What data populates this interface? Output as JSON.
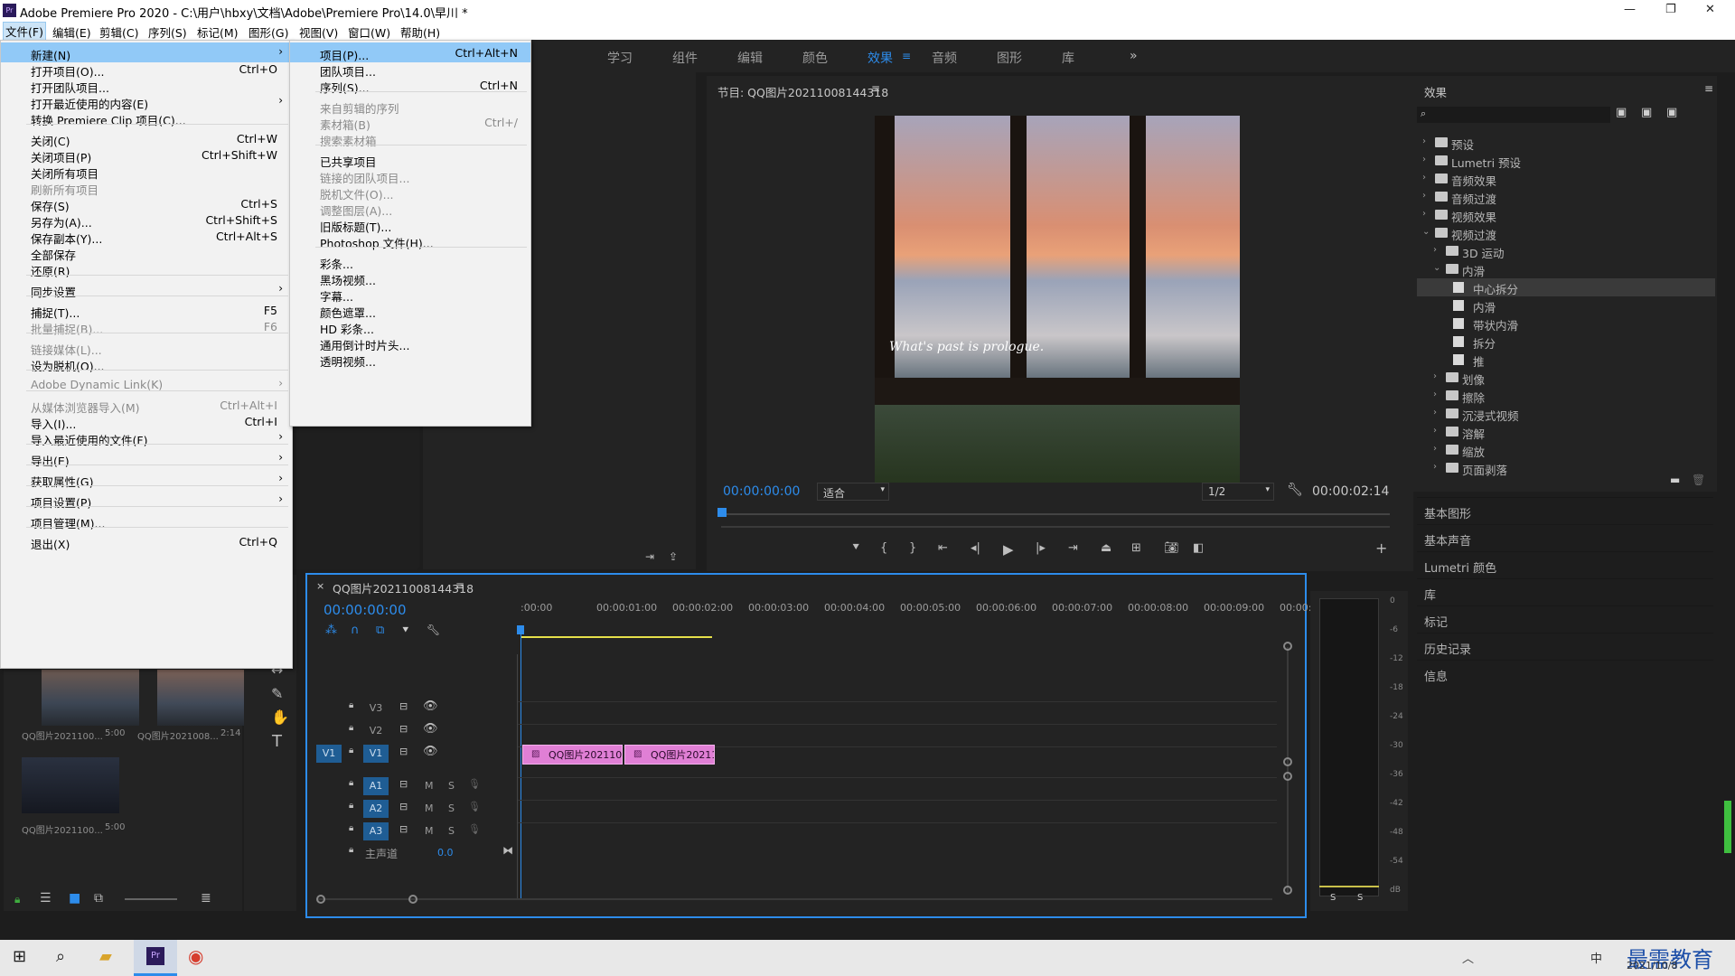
{
  "window": {
    "title": "Adobe Premiere Pro 2020 - C:\\用户\\hbxy\\文档\\Adobe\\Premiere Pro\\14.0\\早川 *",
    "app_icon": "Pr"
  },
  "menubar": [
    "文件(F)",
    "编辑(E)",
    "剪辑(C)",
    "序列(S)",
    "标记(M)",
    "图形(G)",
    "视图(V)",
    "窗口(W)",
    "帮助(H)"
  ],
  "workspaces": [
    "学习",
    "组件",
    "编辑",
    "颜色",
    "效果",
    "音频",
    "图形",
    "库",
    "»"
  ],
  "file_menu": [
    {
      "label": "新建(N)",
      "shortcut": "",
      "submenu": true,
      "disabled": false,
      "highlighted": true
    },
    {
      "label": "打开项目(O)...",
      "shortcut": "Ctrl+O"
    },
    {
      "label": "打开团队项目..."
    },
    {
      "label": "打开最近使用的内容(E)",
      "submenu": true
    },
    {
      "label": "转换 Premiere Clip 项目(C)..."
    },
    {
      "label": "关闭(C)",
      "shortcut": "Ctrl+W"
    },
    {
      "label": "关闭项目(P)",
      "shortcut": "Ctrl+Shift+W"
    },
    {
      "label": "关闭所有项目"
    },
    {
      "label": "刷新所有项目",
      "disabled": true
    },
    {
      "label": "保存(S)",
      "shortcut": "Ctrl+S"
    },
    {
      "label": "另存为(A)...",
      "shortcut": "Ctrl+Shift+S"
    },
    {
      "label": "保存副本(Y)...",
      "shortcut": "Ctrl+Alt+S"
    },
    {
      "label": "全部保存"
    },
    {
      "label": "还原(R)"
    },
    {
      "label": "同步设置",
      "submenu": true
    },
    {
      "label": "捕捉(T)...",
      "shortcut": "F5"
    },
    {
      "label": "批量捕捉(B)...",
      "shortcut": "F6",
      "disabled": true
    },
    {
      "label": "链接媒体(L)...",
      "disabled": true
    },
    {
      "label": "设为脱机(O)..."
    },
    {
      "label": "Adobe Dynamic Link(K)",
      "submenu": true,
      "disabled": true
    },
    {
      "label": "从媒体浏览器导入(M)",
      "shortcut": "Ctrl+Alt+I",
      "disabled": true
    },
    {
      "label": "导入(I)...",
      "shortcut": "Ctrl+I"
    },
    {
      "label": "导入最近使用的文件(F)",
      "submenu": true
    },
    {
      "label": "导出(E)",
      "submenu": true
    },
    {
      "label": "获取属性(G)",
      "submenu": true
    },
    {
      "label": "项目设置(P)",
      "submenu": true
    },
    {
      "label": "项目管理(M)..."
    },
    {
      "label": "退出(X)",
      "shortcut": "Ctrl+Q"
    }
  ],
  "new_submenu": [
    {
      "label": "项目(P)...",
      "shortcut": "Ctrl+Alt+N",
      "highlighted": true
    },
    {
      "label": "团队项目..."
    },
    {
      "label": "序列(S)...",
      "shortcut": "Ctrl+N"
    },
    {
      "label": "来自剪辑的序列",
      "disabled": true
    },
    {
      "label": "素材箱(B)",
      "shortcut": "Ctrl+/",
      "disabled": true
    },
    {
      "label": "搜索素材箱",
      "disabled": true
    },
    {
      "label": "已共享项目"
    },
    {
      "label": "链接的团队项目...",
      "disabled": true
    },
    {
      "label": "脱机文件(O)...",
      "disabled": true
    },
    {
      "label": "调整图层(A)...",
      "disabled": true
    },
    {
      "label": "旧版标题(T)..."
    },
    {
      "label": "Photoshop 文件(H)..."
    },
    {
      "label": "彩条..."
    },
    {
      "label": "黑场视频..."
    },
    {
      "label": "字幕..."
    },
    {
      "label": "颜色遮罩..."
    },
    {
      "label": "HD 彩条..."
    },
    {
      "label": "通用倒计时片头..."
    },
    {
      "label": "透明视频..."
    }
  ],
  "program_monitor": {
    "title": "节目: QQ图片20211008144318",
    "overlay_text": "What's past is prologue.",
    "timecode": "00:00:00:00",
    "fit": "适合",
    "resolution": "1/2",
    "duration": "00:00:02:14"
  },
  "effects_panel": {
    "title": "效果",
    "tree": [
      {
        "label": "预设",
        "level": 0,
        "type": "star-folder",
        "expanded": false
      },
      {
        "label": "Lumetri 预设",
        "level": 0,
        "type": "star-folder",
        "expanded": false
      },
      {
        "label": "音频效果",
        "level": 0,
        "type": "folder",
        "expanded": false
      },
      {
        "label": "音频过渡",
        "level": 0,
        "type": "folder",
        "expanded": false
      },
      {
        "label": "视频效果",
        "level": 0,
        "type": "folder",
        "expanded": false
      },
      {
        "label": "视频过渡",
        "level": 0,
        "type": "folder",
        "expanded": true
      },
      {
        "label": "3D 运动",
        "level": 1,
        "type": "folder",
        "expanded": false
      },
      {
        "label": "内滑",
        "level": 1,
        "type": "folder",
        "expanded": true
      },
      {
        "label": "中心拆分",
        "level": 2,
        "type": "effect",
        "selected": true
      },
      {
        "label": "内滑",
        "level": 2,
        "type": "effect"
      },
      {
        "label": "带状内滑",
        "level": 2,
        "type": "effect"
      },
      {
        "label": "拆分",
        "level": 2,
        "type": "effect"
      },
      {
        "label": "推",
        "level": 2,
        "type": "effect"
      },
      {
        "label": "划像",
        "level": 1,
        "type": "folder",
        "expanded": false
      },
      {
        "label": "擦除",
        "level": 1,
        "type": "folder",
        "expanded": false
      },
      {
        "label": "沉浸式视频",
        "level": 1,
        "type": "folder",
        "expanded": false
      },
      {
        "label": "溶解",
        "level": 1,
        "type": "folder",
        "expanded": false
      },
      {
        "label": "缩放",
        "level": 1,
        "type": "folder",
        "expanded": false
      },
      {
        "label": "页面剥落",
        "level": 1,
        "type": "folder",
        "expanded": false
      }
    ],
    "collapsed_panels": [
      "基本图形",
      "基本声音",
      "Lumetri 颜色",
      "库",
      "标记",
      "历史记录",
      "信息"
    ]
  },
  "timeline": {
    "tab": "QQ图片20211008144318",
    "timecode": "00:00:00:00",
    "ruler": [
      ":00:00",
      "00:00:01:00",
      "00:00:02:00",
      "00:00:03:00",
      "00:00:04:00",
      "00:00:05:00",
      "00:00:06:00",
      "00:00:07:00",
      "00:00:08:00",
      "00:00:09:00",
      "00:00:"
    ],
    "video_tracks": [
      "V3",
      "V2",
      "V1"
    ],
    "source_patch": "V1",
    "audio_tracks": [
      "A1",
      "A2",
      "A3"
    ],
    "master": {
      "label": "主声道",
      "value": "0.0"
    },
    "clips": [
      "QQ图片202110081",
      "QQ图片202110"
    ],
    "track_buttons": {
      "mute": "M",
      "solo": "S"
    }
  },
  "project_bin": {
    "items": [
      {
        "name": "QQ图片2021100...",
        "duration": "5:00"
      },
      {
        "name": "QQ图片2021008...",
        "duration": "2:14"
      },
      {
        "name": "QQ图片2021100...",
        "duration": "5:00"
      }
    ]
  },
  "audio_meter": {
    "scale": [
      "0",
      "-6",
      "-12",
      "-18",
      "-24",
      "-30",
      "-36",
      "-42",
      "-48",
      "-54",
      "dB"
    ],
    "solo_labels": [
      "S",
      "S"
    ]
  },
  "taskbar": {
    "date": "2021/10/8",
    "watermark": "最需教育",
    "ime": "中"
  },
  "colors": {
    "accent": "#2d8ceb",
    "clip": "#e07fd5",
    "menu_highlight": "#91c9f7",
    "timecode": "#2d8ceb"
  }
}
